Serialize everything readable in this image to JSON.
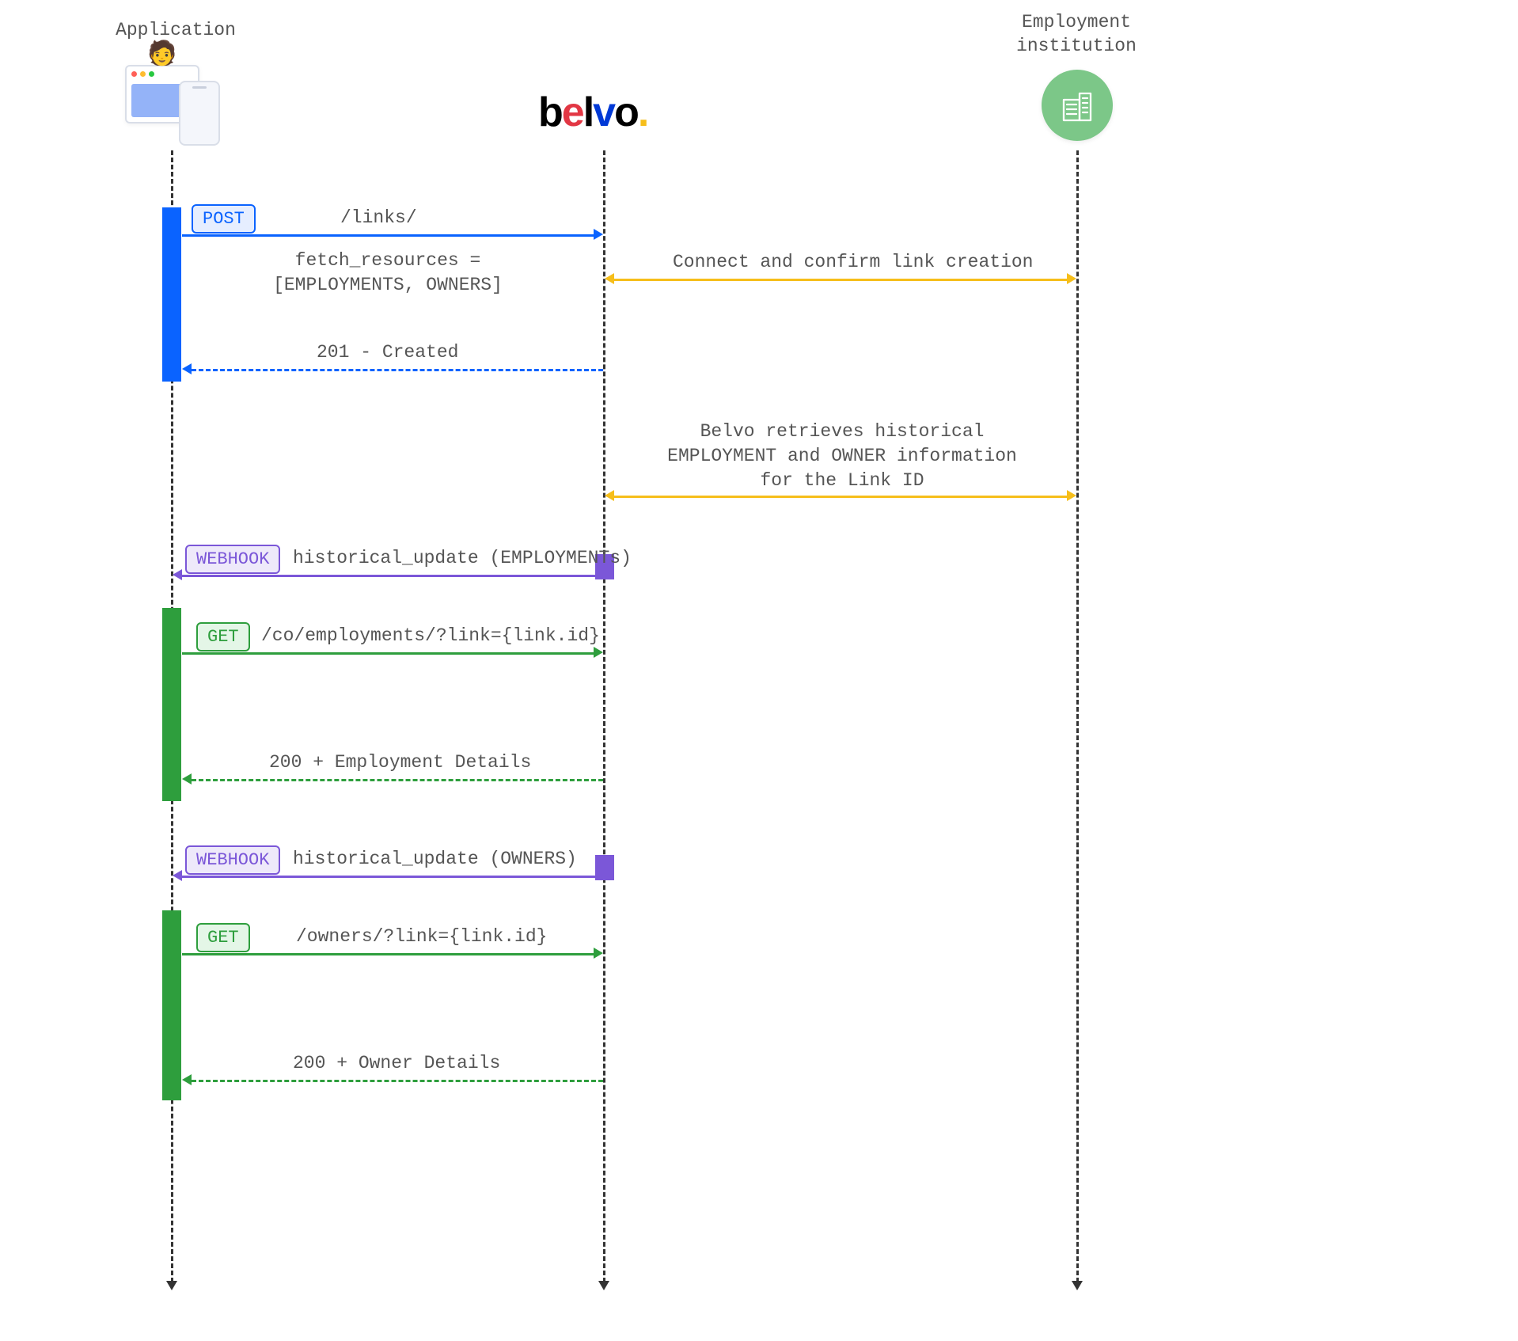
{
  "participants": {
    "application": {
      "label": "Application"
    },
    "belvo": {
      "label": "belvo."
    },
    "institution": {
      "label": "Employment\ninstitution"
    }
  },
  "badges": {
    "post": "POST",
    "webhook": "WEBHOOK",
    "get": "GET"
  },
  "messages": {
    "post_links_path": "/links/",
    "fetch_resources": "fetch_resources =\n[EMPLOYMENTS, OWNERS]",
    "connect_confirm": "Connect and confirm link creation",
    "created_201": "201 - Created",
    "retrieve_historical": "Belvo retrieves historical\nEMPLOYMENT and OWNER information\nfor the Link ID",
    "webhook_employments": "historical_update (EMPLOYMENTs)",
    "get_employments_path": "/co/employments/?link={link.id}",
    "resp_employments": "200 + Employment Details",
    "webhook_owners": "historical_update (OWNERS)",
    "get_owners_path": "/owners/?link={link.id}",
    "resp_owners": "200 + Owner Details"
  },
  "colors": {
    "blue": "#0a63ff",
    "green": "#2e9e3d",
    "purple": "#7b57d8",
    "yellow": "#f6be1a",
    "inst_green": "#7cc788"
  }
}
